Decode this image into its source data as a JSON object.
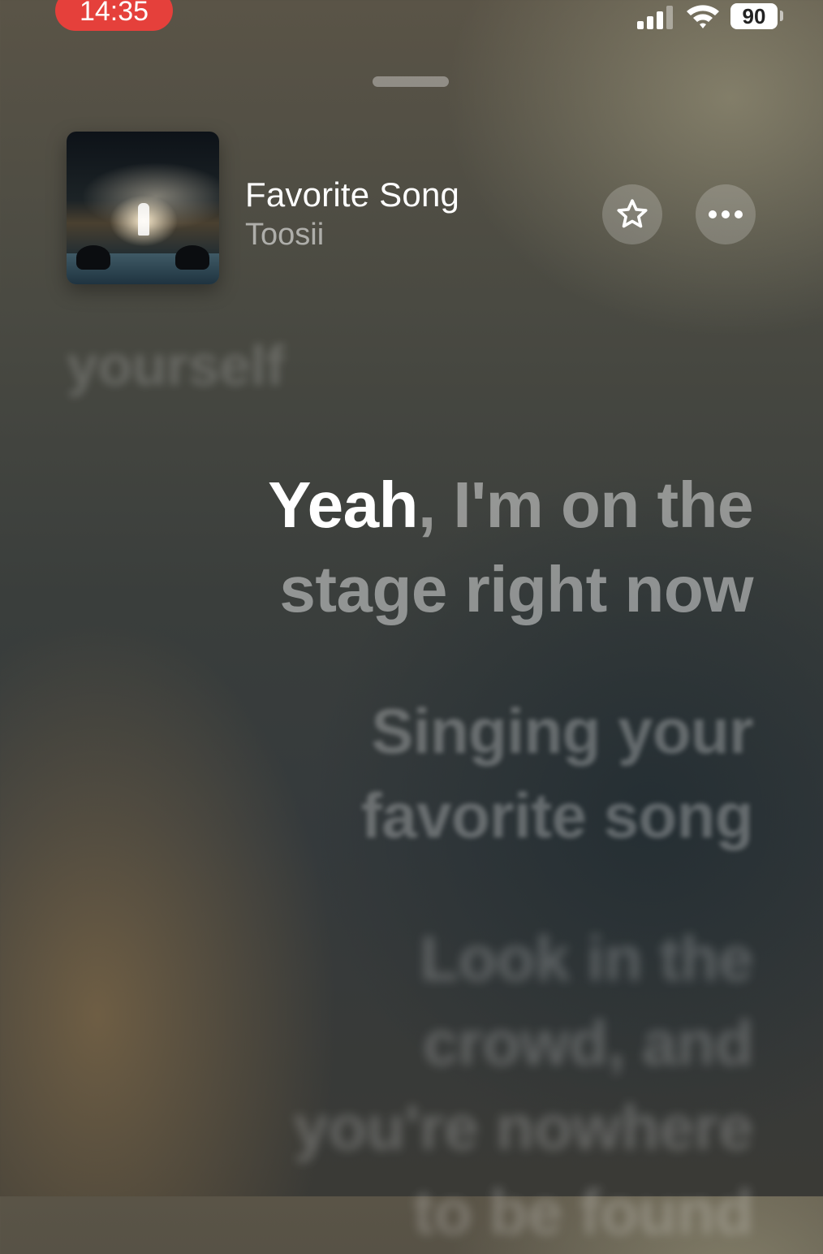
{
  "status_bar": {
    "time": "14:35",
    "battery": "90",
    "icons": [
      "signal-icon",
      "wifi-icon",
      "battery-icon"
    ]
  },
  "now_playing": {
    "title": "Favorite Song",
    "artist": "Toosii",
    "favorite_icon": "star-icon",
    "more_icon": "ellipsis-icon"
  },
  "lyrics": {
    "previous": "yourself",
    "current_sung": "Yeah",
    "current_rest_line1": ", I'm on the",
    "current_line2": "stage right now",
    "next1_line1": "Singing your",
    "next1_line2": "favorite song",
    "next2_line1": "Look in the",
    "next2_line2": "crowd, and",
    "next2_line3": "you're nowhere",
    "next2_line4": "to be found"
  },
  "colors": {
    "time_pill": "#e5403b",
    "lyric_active": "#ffffff"
  }
}
